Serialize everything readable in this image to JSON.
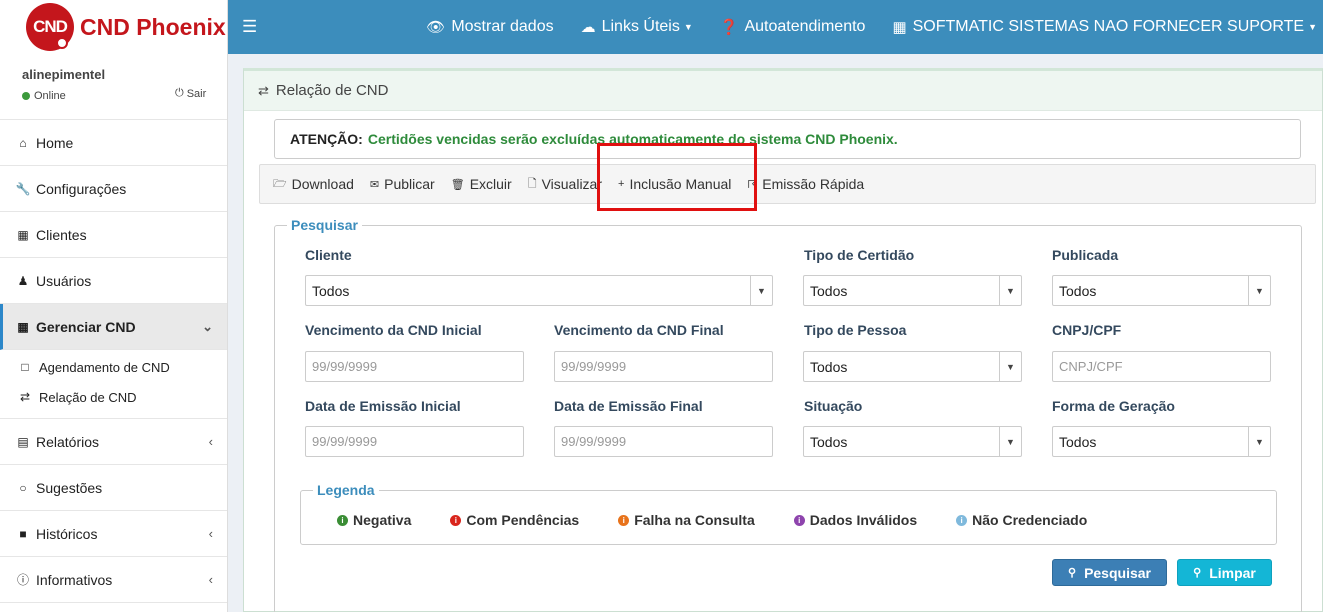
{
  "app": {
    "logo_mark": "CND",
    "logo_text": "CND Phoenix"
  },
  "user": {
    "name": "alinepimentel",
    "status": "Online",
    "logout": "Sair"
  },
  "sidebar": {
    "items": [
      {
        "label": "Home",
        "icon": "home-icon"
      },
      {
        "label": "Configurações",
        "icon": "wrench-icon"
      },
      {
        "label": "Clientes",
        "icon": "building-icon"
      },
      {
        "label": "Usuários",
        "icon": "user-icon"
      },
      {
        "label": "Gerenciar CND",
        "icon": "calendar-icon"
      },
      {
        "label": "Relatórios",
        "icon": "file-icon"
      },
      {
        "label": "Sugestões",
        "icon": "comments-icon"
      },
      {
        "label": "Históricos",
        "icon": "archive-icon"
      },
      {
        "label": "Informativos",
        "icon": "info-icon"
      }
    ],
    "submenu": [
      {
        "label": "Agendamento de CND",
        "icon": "calendar-outline-icon"
      },
      {
        "label": "Relação de CND",
        "icon": "retweet-icon"
      }
    ]
  },
  "topbar": {
    "items": [
      {
        "label": "Mostrar dados",
        "icon": "eye-icon"
      },
      {
        "label": "Links Úteis",
        "icon": "cloud-icon"
      },
      {
        "label": "Autoatendimento",
        "icon": "question-circle-icon"
      },
      {
        "label": "SOFTMATIC SISTEMAS NAO FORNECER SUPORTE",
        "icon": "building-icon"
      }
    ]
  },
  "page": {
    "title": "Relação de CND",
    "alert_label": "ATENÇÃO:",
    "alert_message": "Certidões vencidas serão excluídas automaticamente do sistema CND Phoenix."
  },
  "toolbar": {
    "download": "Download",
    "publicar": "Publicar",
    "excluir": "Excluir",
    "visualizar": "Visualizar",
    "inclusao_manual": "Inclusão Manual",
    "emissao_rapida": "Emissão Rápida"
  },
  "search": {
    "title": "Pesquisar",
    "cliente_label": "Cliente",
    "cliente_value": "Todos",
    "tipo_certidao_label": "Tipo de Certidão",
    "tipo_certidao_value": "Todos",
    "publicada_label": "Publicada",
    "publicada_value": "Todos",
    "venc_inicial_label": "Vencimento da CND Inicial",
    "venc_inicial_placeholder": "99/99/9999",
    "venc_final_label": "Vencimento da CND Final",
    "venc_final_placeholder": "99/99/9999",
    "tipo_pessoa_label": "Tipo de Pessoa",
    "tipo_pessoa_value": "Todos",
    "cnpj_label": "CNPJ/CPF",
    "cnpj_placeholder": "CNPJ/CPF",
    "emissao_inicial_label": "Data de Emissão Inicial",
    "emissao_inicial_placeholder": "99/99/9999",
    "emissao_final_label": "Data de Emissão Final",
    "emissao_final_placeholder": "99/99/9999",
    "situacao_label": "Situação",
    "situacao_value": "Todos",
    "forma_geracao_label": "Forma de Geração",
    "forma_geracao_value": "Todos",
    "search_button": "Pesquisar",
    "clear_button": "Limpar"
  },
  "legend": {
    "title": "Legenda",
    "items": [
      {
        "label": "Negativa",
        "color": "#3a8d35"
      },
      {
        "label": "Com Pendências",
        "color": "#d9251c"
      },
      {
        "label": "Falha na Consulta",
        "color": "#e8731b"
      },
      {
        "label": "Dados Inválidos",
        "color": "#8e44ad"
      },
      {
        "label": "Não Credenciado",
        "color": "#7fb9dc"
      }
    ]
  }
}
